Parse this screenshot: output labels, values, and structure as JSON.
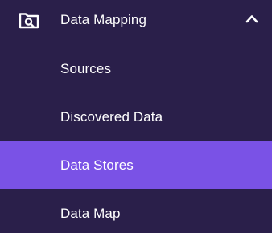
{
  "nav": {
    "section": {
      "label": "Data Mapping",
      "icon": "folder-search-icon",
      "expand_icon": "chevron-up-icon",
      "expanded": true
    },
    "items": [
      {
        "label": "Sources",
        "active": false
      },
      {
        "label": "Discovered Data",
        "active": false
      },
      {
        "label": "Data Stores",
        "active": true
      },
      {
        "label": "Data Map",
        "active": false
      }
    ],
    "colors": {
      "background": "#2a1f4a",
      "active": "#7a52e6",
      "text": "#ffffff"
    }
  }
}
